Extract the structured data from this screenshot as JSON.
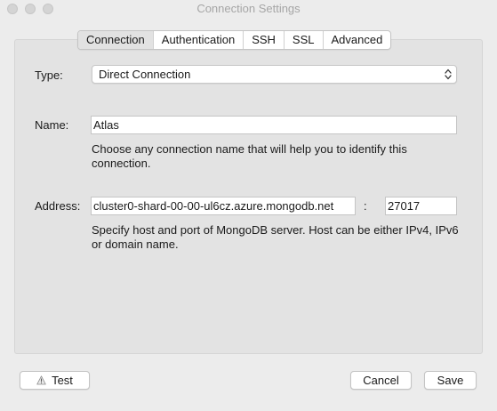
{
  "window": {
    "title": "Connection Settings"
  },
  "tabs": [
    {
      "label": "Connection",
      "selected": true
    },
    {
      "label": "Authentication",
      "selected": false
    },
    {
      "label": "SSH",
      "selected": false
    },
    {
      "label": "SSL",
      "selected": false
    },
    {
      "label": "Advanced",
      "selected": false
    }
  ],
  "form": {
    "type": {
      "label": "Type:",
      "value": "Direct Connection"
    },
    "name": {
      "label": "Name:",
      "value": "Atlas",
      "help": "Choose any connection name that will help you to identify this connection."
    },
    "address": {
      "label": "Address:",
      "host": "cluster0-shard-00-00-ul6cz.azure.mongodb.net",
      "separator": ":",
      "port": "27017",
      "help": "Specify host and port of MongoDB server. Host can be either IPv4, IPv6 or domain name."
    }
  },
  "buttons": {
    "test": "Test",
    "cancel": "Cancel",
    "save": "Save"
  },
  "icons": {
    "test_button_icon": "warning-icon"
  },
  "colors": {
    "window_bg": "#ececec",
    "panel_bg": "#e3e3e3",
    "selected_tab_bg": "#e2e2e2",
    "title_text": "#a6a6a6"
  }
}
